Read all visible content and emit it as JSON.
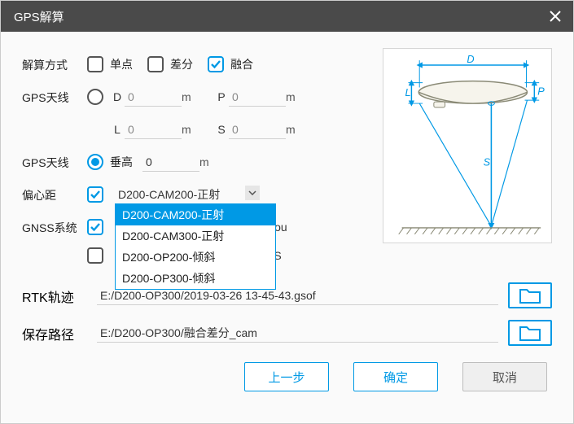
{
  "title": "GPS解算",
  "labels": {
    "mode": "解算方式",
    "antenna1": "GPS天线",
    "antenna2": "GPS天线",
    "offset": "偏心距",
    "gnss": "GNSS系统",
    "rtk": "RTK轨迹",
    "save": "保存路径"
  },
  "mode": {
    "single": {
      "label": "单点",
      "checked": false
    },
    "diff": {
      "label": "差分",
      "checked": false
    },
    "fusion": {
      "label": "融合",
      "checked": true
    }
  },
  "antenna1": {
    "D": {
      "label": "D",
      "value": "0",
      "unit": "m"
    },
    "P": {
      "label": "P",
      "value": "0",
      "unit": "m"
    },
    "L": {
      "label": "L",
      "value": "0",
      "unit": "m"
    },
    "S": {
      "label": "S",
      "value": "0",
      "unit": "m"
    }
  },
  "antenna2": {
    "vertical": {
      "label": "垂高",
      "value": "0",
      "unit": "m"
    }
  },
  "offset": {
    "checked": true,
    "selected": "D200-CAM200-正射",
    "options": [
      "D200-CAM200-正射",
      "D200-CAM300-正射",
      "D200-OP200-倾斜",
      "D200-OP300-倾斜"
    ]
  },
  "gnss": {
    "row1": {
      "checked": true,
      "tail": "Dou"
    },
    "row2": {
      "checked": false,
      "tail": "AS"
    }
  },
  "paths": {
    "rtk": "E:/D200-OP300/2019-03-26 13-45-43.gsof",
    "save": "E:/D200-OP300/融合差分_cam"
  },
  "buttons": {
    "prev": "上一步",
    "ok": "确定",
    "cancel": "取消"
  },
  "diagram": {
    "D": "D",
    "L": "L",
    "P": "P",
    "S": "S"
  }
}
